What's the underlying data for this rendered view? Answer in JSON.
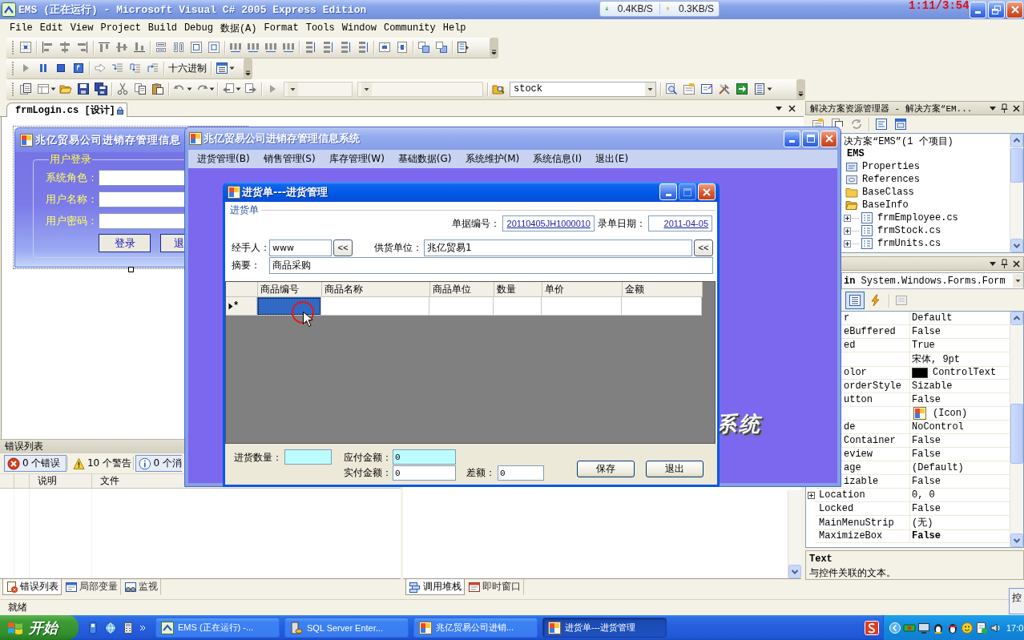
{
  "ide": {
    "title": "EMS (正在运行) - Microsoft Visual C# 2005 Express Edition",
    "playback_time": "1:11/3:54"
  },
  "net_speed": {
    "download": "0.4KB/S",
    "upload": "0.3KB/S"
  },
  "menu": [
    "File",
    "Edit",
    "View",
    "Project",
    "Build",
    "Debug",
    "数据(A)",
    "Format",
    "Tools",
    "Window",
    "Community",
    "Help"
  ],
  "debug_toolbar": {
    "display_mode": "十六进制"
  },
  "standard_toolbar": {
    "startup_project": "stock"
  },
  "document_tab": {
    "label": "frmLogin.cs [设计]"
  },
  "login_form": {
    "title": "兆亿贸易公司进销存管理信息",
    "group": "用户登录",
    "fields": [
      "系统角色：",
      "用户名称：",
      "用户密码："
    ],
    "buttons": [
      "登录",
      "退"
    ]
  },
  "error_list": {
    "title": "错误列表",
    "filters": [
      {
        "kind": "error",
        "label": "0 个错误",
        "selected": true
      },
      {
        "kind": "warning",
        "label": "10 个警告",
        "selected": false
      },
      {
        "kind": "info",
        "label": "0 个消",
        "selected": true
      }
    ],
    "columns": [
      "说明",
      "文件"
    ]
  },
  "tool_tabs_left": [
    {
      "kind": "errors",
      "label": "错误列表",
      "selected": true
    },
    {
      "kind": "locals",
      "label": "局部变量",
      "selected": false
    },
    {
      "kind": "watch",
      "label": "监视",
      "selected": false
    }
  ],
  "tool_tabs_right": [
    {
      "kind": "callstack",
      "label": "调用堆栈",
      "selected": true
    },
    {
      "kind": "immediate",
      "label": "即时窗口",
      "selected": false
    }
  ],
  "solution_explorer": {
    "title": "解决方案资源管理器 - 解决方案“EM...",
    "tree": [
      {
        "label": "决方案“EMS”(1 个项目)",
        "children": [
          {
            "kind": "project",
            "label": "EMS",
            "children": [
              {
                "kind": "properties",
                "label": "Properties"
              },
              {
                "kind": "references",
                "label": "References"
              },
              {
                "kind": "folder",
                "label": "BaseClass"
              },
              {
                "kind": "folder-open",
                "label": "BaseInfo",
                "children": [
                  {
                    "kind": "form",
                    "label": "frmEmployee.cs",
                    "expanded": false
                  },
                  {
                    "kind": "form",
                    "label": "frmStock.cs",
                    "expanded": false
                  },
                  {
                    "kind": "form",
                    "label": "frmUnits.cs",
                    "expanded": false
                  }
                ]
              }
            ]
          }
        ]
      }
    ]
  },
  "properties": {
    "object": "**in** System.Windows.Forms.Form",
    "views": [
      {
        "kind": "alphabetical",
        "selected": true
      },
      {
        "kind": "events",
        "selected": false
      }
    ],
    "rows": [
      {
        "kind": "text",
        "name": "r",
        "value": "Default",
        "modified": false
      },
      {
        "kind": "text",
        "name": "eBuffered",
        "value": "False",
        "modified": false
      },
      {
        "kind": "text",
        "name": "ed",
        "value": "True",
        "modified": false
      },
      {
        "kind": "text",
        "value": "宋体, 9pt",
        "modified": false
      },
      {
        "kind": "color",
        "name": "olor",
        "value": "ControlText",
        "color": "#000000",
        "modified": false
      },
      {
        "kind": "text",
        "name": "orderStyle",
        "value": "Sizable",
        "modified": false
      },
      {
        "kind": "text",
        "name": "utton",
        "value": "False",
        "modified": false
      },
      {
        "kind": "icon",
        "value": "(Icon)",
        "modified": false
      },
      {
        "kind": "text",
        "name": "de",
        "value": "NoControl",
        "modified": false
      },
      {
        "kind": "text",
        "name": "Container",
        "value": "False",
        "modified": false
      },
      {
        "kind": "text",
        "name": "eview",
        "value": "False",
        "modified": false
      },
      {
        "kind": "text",
        "name": "age",
        "value": "(Default)",
        "modified": false
      },
      {
        "kind": "text",
        "name": "izable",
        "value": "False",
        "modified": false
      },
      {
        "kind": "group",
        "name": "Location",
        "value": "0, 0",
        "modified": false
      },
      {
        "kind": "text",
        "name": "Locked",
        "value": "False",
        "modified": false
      },
      {
        "kind": "text",
        "name": "MainMenuStrip",
        "value": "(无)",
        "modified": false
      },
      {
        "kind": "text",
        "name": "MaximizeBox",
        "value": "False",
        "modified": true
      }
    ],
    "description": {
      "title": "Text",
      "text": "与控件关联的文本。"
    }
  },
  "status_bar": "就绪",
  "taskbar": {
    "start": "开始",
    "items": [
      {
        "kind": "ide",
        "label": "EMS (正在运行) -...",
        "selected": false
      },
      {
        "kind": "database",
        "label": "SQL Server Enter...",
        "selected": false
      },
      {
        "kind": "app",
        "label": "兆亿贸易公司进销...",
        "selected": false
      },
      {
        "kind": "app",
        "label": "进货单---进货管理",
        "selected": true
      }
    ],
    "clock": "17:0"
  },
  "edge_window": {
    "title": "控"
  },
  "app_window": {
    "title": "兆亿贸易公司进销存管理信息系统",
    "menu": [
      "进货管理(B)",
      "销售管理(S)",
      "库存管理(W)",
      "基础数据(G)",
      "系统维护(M)",
      "系统信息(I)",
      "退出(E)"
    ],
    "banner": "系统"
  },
  "purchase_dialog": {
    "title": "进货单---进货管理",
    "window_buttons": [
      {
        "kind": "minimize",
        "disabled": false
      },
      {
        "kind": "maximize",
        "disabled": true
      },
      {
        "kind": "close",
        "disabled": false
      }
    ],
    "group": "进货单",
    "bill_no": {
      "label": "单据编号：",
      "value": "20110405JH1000010"
    },
    "entry_date": {
      "label": "录单日期：",
      "value": "2011-04-05"
    },
    "handler": {
      "label": "经手人：",
      "value": "www",
      "button": "<<"
    },
    "supplier": {
      "label": "供货单位：",
      "value": "兆亿贸易1",
      "button": "<<"
    },
    "summary": {
      "label": "摘要：",
      "value": "商品采购"
    },
    "grid": {
      "columns": [
        "商品编号",
        "商品名称",
        "商品单位",
        "数量",
        "单价",
        "金额"
      ],
      "new_row": {
        "marker": "*",
        "cells": [
          {
            "selected": true
          },
          {
            "selected": false
          },
          {
            "selected": false
          },
          {
            "selected": false
          },
          {
            "selected": false
          },
          {
            "selected": false
          }
        ]
      }
    },
    "totals": [
      {
        "label": "进货数量：",
        "highlighted": true
      },
      {
        "label": "应付金额：",
        "value": "0",
        "highlighted": true
      },
      {
        "label": "实付金额：",
        "value": "0",
        "highlighted": false
      },
      {
        "label": "差额：",
        "value": "0",
        "highlighted": false
      }
    ],
    "buttons": [
      "保存",
      "退出"
    ]
  }
}
